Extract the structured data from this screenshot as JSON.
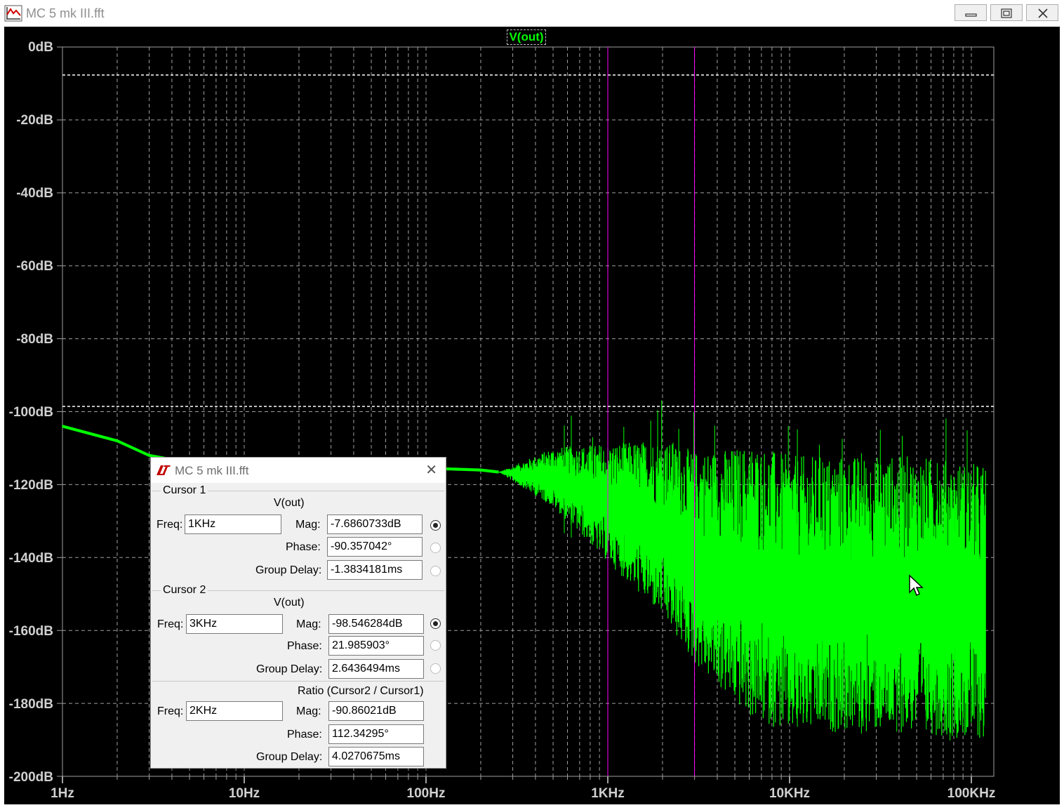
{
  "window": {
    "title": "MC 5 mk III.fft",
    "buttons": [
      "minimize",
      "maximize",
      "close"
    ]
  },
  "plot": {
    "trace_label": "V(out)",
    "y_ticks": [
      "0dB",
      "-20dB",
      "-40dB",
      "-60dB",
      "-80dB",
      "-100dB",
      "-120dB",
      "-140dB",
      "-160dB",
      "-180dB",
      "-200dB"
    ],
    "x_ticks": [
      "1Hz",
      "10Hz",
      "100Hz",
      "1KHz",
      "10KHz",
      "100KHz"
    ],
    "colors": {
      "background": "#000000",
      "trace": "#00ff00",
      "grid": "#a0a0a0",
      "cursor_line": "#ff00ff"
    }
  },
  "chart_data": {
    "type": "line",
    "title": "",
    "xlabel": "",
    "ylabel": "",
    "x_scale": "log",
    "xlim_hz": [
      1,
      120000
    ],
    "ylim_db": [
      -200,
      0
    ],
    "grid": true,
    "series": [
      {
        "name": "V(out)",
        "color": "#00ff00",
        "x_hz": [
          1,
          2,
          3,
          5,
          10,
          20,
          50,
          100,
          200,
          300,
          500,
          1000,
          2000,
          3000,
          5000,
          10000,
          20000,
          50000,
          100000,
          120000
        ],
        "y_db": [
          -104,
          -108,
          -112,
          -114,
          -115,
          -115,
          -115.5,
          -115.5,
          -116,
          -117,
          -118,
          -125,
          -132,
          -140,
          -145,
          -150,
          -150,
          -150,
          -152,
          -152
        ],
        "noise_band": "wide noise band above ~2KHz, roughly -100dB to -190dB"
      }
    ],
    "cursors": [
      {
        "freq": "1KHz",
        "mag_db": -7.6860733
      },
      {
        "freq": "3KHz",
        "mag_db": -98.546284
      }
    ]
  },
  "dialog": {
    "title": "MC 5 mk III.fft",
    "cursor1": {
      "group": "Cursor 1",
      "trace": "V(out)",
      "freq_label": "Freq:",
      "freq": "1KHz",
      "mag_label": "Mag:",
      "mag": "-7.6860733dB",
      "phase_label": "Phase:",
      "phase": "-90.357042°",
      "gd_label": "Group Delay:",
      "gd": "-1.3834181ms"
    },
    "cursor2": {
      "group": "Cursor 2",
      "trace": "V(out)",
      "freq_label": "Freq:",
      "freq": "3KHz",
      "mag_label": "Mag:",
      "mag": "-98.546284dB",
      "phase_label": "Phase:",
      "phase": "21.985903°",
      "gd_label": "Group Delay:",
      "gd": "2.6436494ms"
    },
    "ratio": {
      "group": "Ratio (Cursor2 / Cursor1)",
      "freq_label": "Freq:",
      "freq": "2KHz",
      "mag_label": "Mag:",
      "mag": "-90.86021dB",
      "phase_label": "Phase:",
      "phase": "112.34295°",
      "gd_label": "Group Delay:",
      "gd": "4.0270675ms"
    }
  }
}
